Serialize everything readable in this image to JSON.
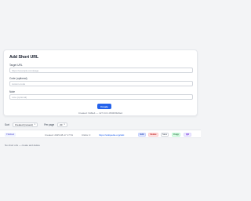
{
  "form": {
    "title": "Add Short URL",
    "target": {
      "label": "Target URL",
      "placeholder": "https://example.com/page"
    },
    "code": {
      "label": "Code (optional)",
      "placeholder": "custom-code"
    },
    "note": {
      "label": "Note",
      "placeholder": "note (optional)"
    },
    "create_label": "Create",
    "status": "Created: f4d9e4 — 127.0.0.1:8000/f4d9e4"
  },
  "controls": {
    "sort_label": "Sort",
    "sort_value": "Created (newest)",
    "per_page_label": "Per page",
    "per_page_value": "20"
  },
  "links": [
    {
      "code": "f4d9e4",
      "created": "Created: 2025-08-17 17:51",
      "clicks": "Clicks: 0",
      "target": "https://wikipedia.org/wiki",
      "actions": {
        "edit": "Edit",
        "delete": "Delete",
        "save": "Save",
        "copy": "Copy",
        "qr": "QR"
      }
    }
  ],
  "footer": "No short urls — create and delete"
}
